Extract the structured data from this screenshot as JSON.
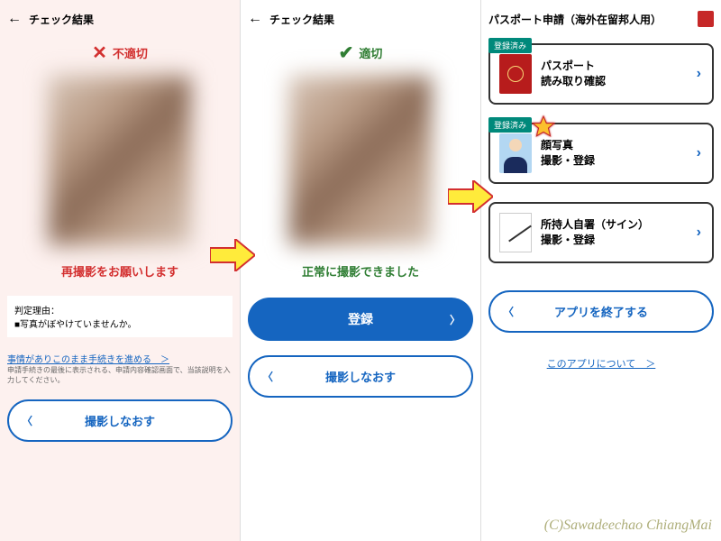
{
  "screen1": {
    "header_title": "チェック結果",
    "status_label": "不適切",
    "message": "再撮影をお願いします",
    "reason_title": "判定理由：",
    "reason_body": "■写真がぼやけていませんか。",
    "proceed_link": "事情がありこのまま手続きを進める　＞",
    "proceed_note": "申請手続きの最後に表示される、申請内容確認画面で、当該説明を入力してください。",
    "retake_btn": "撮影しなおす"
  },
  "screen2": {
    "header_title": "チェック結果",
    "status_label": "適切",
    "message": "正常に撮影できました",
    "register_btn": "登録",
    "retake_btn": "撮影しなおす"
  },
  "screen3": {
    "header_title": "パスポート申請（海外在留邦人用）",
    "badge_registered": "登録済み",
    "item1_line1": "パスポート",
    "item1_line2": "読み取り確認",
    "item2_line1": "顔写真",
    "item2_line2": "撮影・登録",
    "item3_line1": "所持人自署（サイン）",
    "item3_line2": "撮影・登録",
    "exit_btn": "アプリを終了する",
    "about_link": "このアプリについて　＞"
  },
  "watermark": "(C)Sawadeechao ChiangMai"
}
